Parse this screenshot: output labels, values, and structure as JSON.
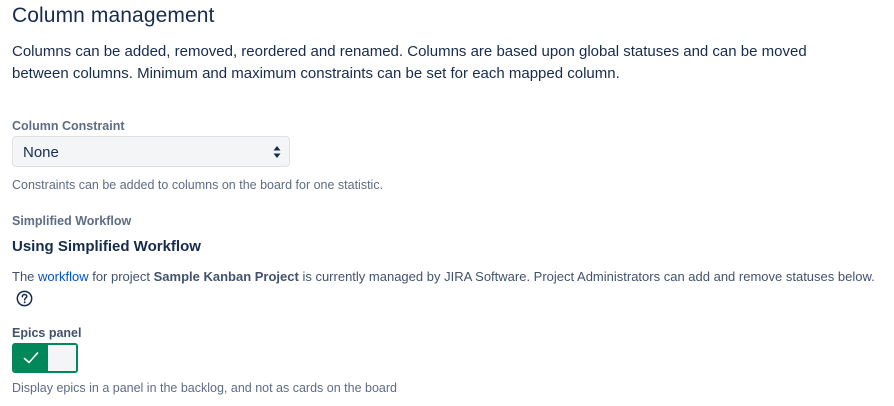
{
  "title": "Column management",
  "intro": {
    "line1": "Columns can be added, removed, reordered and renamed. Columns are based upon global statuses and can be moved",
    "line2": "between columns. Minimum and maximum constraints can be set for each mapped column."
  },
  "column_constraint": {
    "label": "Column Constraint",
    "selected": "None",
    "help": "Constraints can be added to columns on the board for one statistic."
  },
  "simplified_workflow": {
    "label": "Simplified Workflow",
    "heading": "Using Simplified Workflow",
    "text_before_link": "The ",
    "link_text": "workflow",
    "text_after_link": " for project ",
    "project_name": "Sample Kanban Project",
    "text_after_project": " is currently managed by JIRA Software. Project Administrators can add and remove statuses below.",
    "help_icon": "question-circle-icon"
  },
  "epics_panel": {
    "label": "Epics panel",
    "enabled": true,
    "toggle_icon": "check-icon",
    "help": "Display epics in a panel in the backlog, and not as cards on the board"
  },
  "colors": {
    "text": "#172b4d",
    "muted": "#5e6c84",
    "link": "#0052cc",
    "toggle_on": "#00875a"
  }
}
